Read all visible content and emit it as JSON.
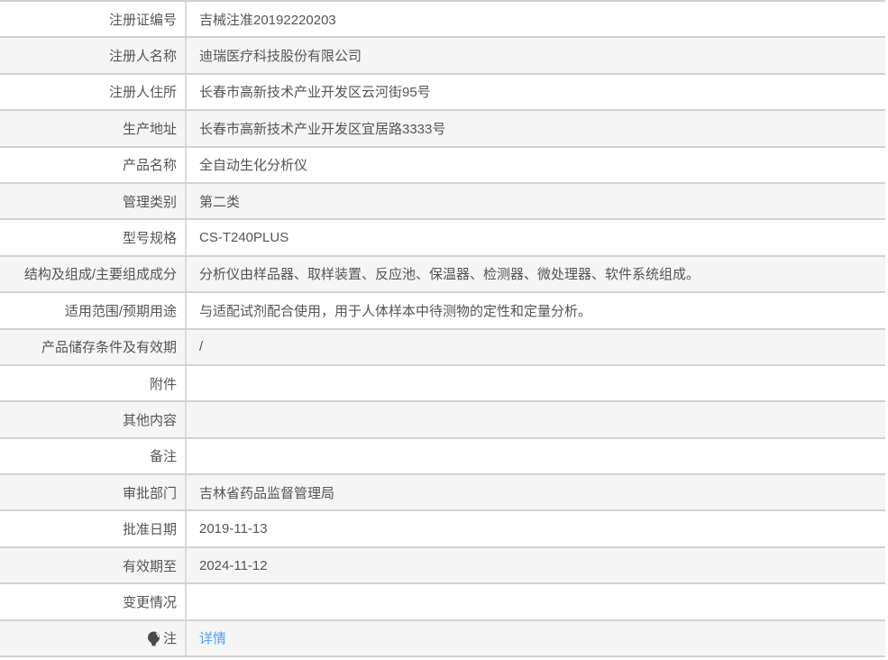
{
  "colors": {
    "row_bg": "#ffffff",
    "row_alt_bg": "#f5f5f5",
    "border_horizontal": "#d2d2d2",
    "border_vertical": "#dbdbdb",
    "text": "#555555",
    "link": "#4f9ef0"
  },
  "icons": {
    "note_icon": "lightbulb-icon"
  },
  "table": {
    "rows": [
      {
        "label": "注册证编号",
        "value": "吉械注准20192220203"
      },
      {
        "label": "注册人名称",
        "value": "迪瑞医疗科技股份有限公司"
      },
      {
        "label": "注册人住所",
        "value": "长春市高新技术产业开发区云河街95号"
      },
      {
        "label": "生产地址",
        "value": "长春市高新技术产业开发区宜居路3333号"
      },
      {
        "label": "产品名称",
        "value": "全自动生化分析仪"
      },
      {
        "label": "管理类别",
        "value": "第二类"
      },
      {
        "label": "型号规格",
        "value": "CS-T240PLUS"
      },
      {
        "label": "结构及组成/主要组成成分",
        "value": "分析仪由样品器、取样装置、反应池、保温器、检测器、微处理器、软件系统组成。"
      },
      {
        "label": "适用范围/预期用途",
        "value": "与适配试剂配合使用，用于人体样本中待测物的定性和定量分析。"
      },
      {
        "label": "产品储存条件及有效期",
        "value": "/"
      },
      {
        "label": "附件",
        "value": ""
      },
      {
        "label": "其他内容",
        "value": ""
      },
      {
        "label": "备注",
        "value": ""
      },
      {
        "label": "审批部门",
        "value": "吉林省药品监督管理局"
      },
      {
        "label": "批准日期",
        "value": "2019-11-13"
      },
      {
        "label": "有效期至",
        "value": "2024-11-12"
      },
      {
        "label": "变更情况",
        "value": ""
      },
      {
        "label": "注",
        "value": "详情",
        "label_icon": "lightbulb-icon",
        "value_is_link": true
      }
    ]
  }
}
